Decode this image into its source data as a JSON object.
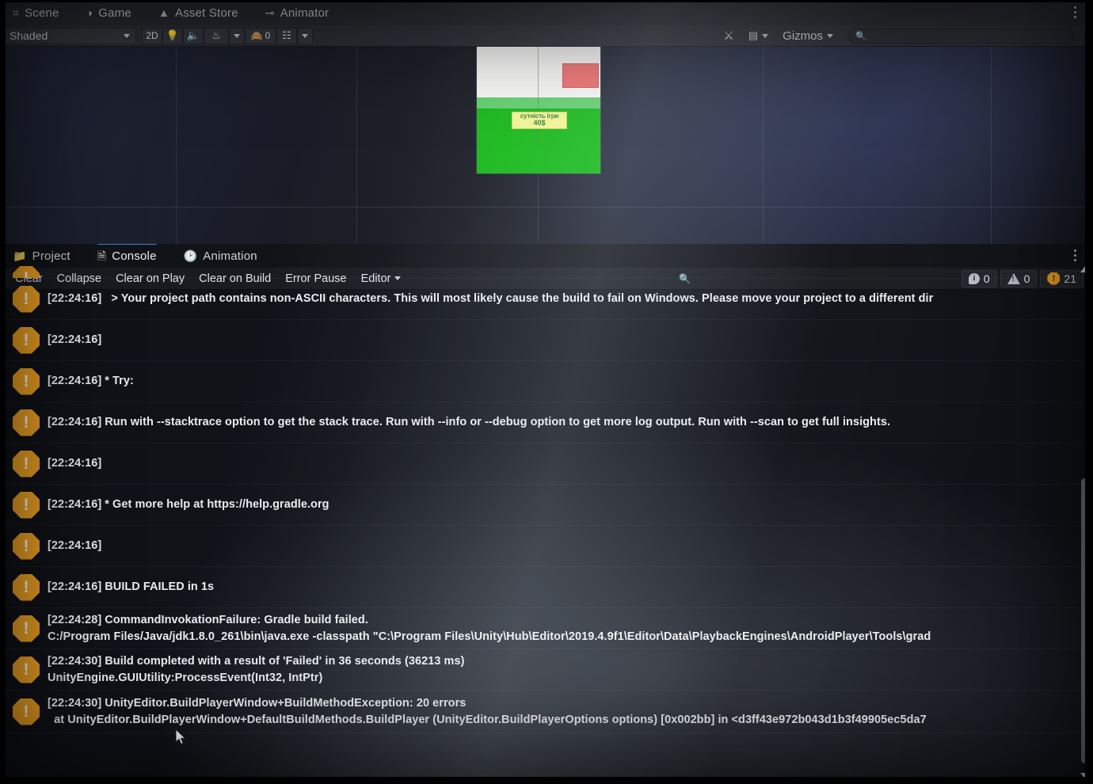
{
  "scene_view": {
    "tabs": [
      {
        "label": "Scene",
        "icon": "grid-icon",
        "glyph": "⌗",
        "active": false
      },
      {
        "label": "Game",
        "icon": "gamepad-icon",
        "glyph": "◑",
        "active": false
      },
      {
        "label": "Asset Store",
        "icon": "shopping-bag-icon",
        "glyph": "▲",
        "active": false
      },
      {
        "label": "Animator",
        "icon": "animator-icon",
        "glyph": "⊸",
        "active": false
      }
    ],
    "toolbar": {
      "draw_mode": "Shaded",
      "two_d_label": "2D",
      "lighting_icon": "lightbulb-icon",
      "audio_icon": "speaker-icon",
      "fx_icon": "effects-icon",
      "hidden_objects_icon": "eye-slash-icon",
      "hidden_objects_count": "0",
      "scene_visibility_icon": "scene-visibility-icon",
      "tools_icon": "tools-icon",
      "camera_icon": "camera-icon",
      "gizmos_label": "Gizmos",
      "search_placeholder": ""
    },
    "game_object": {
      "label_line1": "сутність ігри",
      "label_line2": "40$",
      "sky_color": "#fbfbf9",
      "ground_color": "#0fb50f",
      "ground_light_color": "#5fcf6a",
      "box_color": "#f26b6b",
      "label_bg": "#f2f58f"
    }
  },
  "console": {
    "tabs": [
      {
        "label": "Project",
        "icon": "folder-icon",
        "glyph": "▰",
        "active": false
      },
      {
        "label": "Console",
        "icon": "console-icon",
        "glyph": "⌸",
        "active": true
      },
      {
        "label": "Animation",
        "icon": "clock-icon",
        "glyph": "◔",
        "active": false
      }
    ],
    "toolbar": {
      "clear": "Clear",
      "collapse": "Collapse",
      "clear_on_play": "Clear on Play",
      "clear_on_build": "Clear on Build",
      "error_pause": "Error Pause",
      "editor": "Editor",
      "search_icon": "search-icon",
      "search_value": "",
      "search_placeholder": ""
    },
    "counters": {
      "info_icon": "info-icon",
      "info_count": "0",
      "warning_icon": "warning-icon",
      "warning_count": "0",
      "error_icon": "error-icon",
      "error_count": "21"
    },
    "log_entries": [
      {
        "icon": "error-icon",
        "clipped_top": true,
        "line1": "",
        "line2": ""
      },
      {
        "icon": "error-icon",
        "line1": "[22:24:16]   > Your project path contains non-ASCII characters. This will most likely cause the build to fail on Windows. Please move your project to a different dir",
        "line2": ""
      },
      {
        "icon": "error-icon",
        "line1": "[22:24:16]",
        "line2": ""
      },
      {
        "icon": "error-icon",
        "line1": "[22:24:16] * Try:",
        "line2": ""
      },
      {
        "icon": "error-icon",
        "line1": "[22:24:16] Run with --stacktrace option to get the stack trace. Run with --info or --debug option to get more log output. Run with --scan to get full insights.",
        "line2": ""
      },
      {
        "icon": "error-icon",
        "line1": "[22:24:16]",
        "line2": ""
      },
      {
        "icon": "error-icon",
        "line1": "[22:24:16] * Get more help at https://help.gradle.org",
        "line2": ""
      },
      {
        "icon": "error-icon",
        "line1": "[22:24:16]",
        "line2": ""
      },
      {
        "icon": "error-icon",
        "line1": "[22:24:16] BUILD FAILED in 1s",
        "line2": ""
      },
      {
        "icon": "error-icon",
        "line1": "[22:24:28] CommandInvokationFailure: Gradle build failed.",
        "line2": "C:/Program Files/Java/jdk1.8.0_261\\bin\\java.exe -classpath \"C:\\Program Files\\Unity\\Hub\\Editor\\2019.4.9f1\\Editor\\Data\\PlaybackEngines\\AndroidPlayer\\Tools\\grad"
      },
      {
        "icon": "error-icon",
        "line1": "[22:24:30] Build completed with a result of 'Failed' in 36 seconds (36213 ms)",
        "line2": "UnityEngine.GUIUtility:ProcessEvent(Int32, IntPtr)"
      },
      {
        "icon": "error-icon",
        "line1": "[22:24:30] UnityEditor.BuildPlayerWindow+BuildMethodException: 20 errors",
        "line2": "  at UnityEditor.BuildPlayerWindow+DefaultBuildMethods.BuildPlayer (UnityEditor.BuildPlayerOptions options) [0x002bb] in <d3ff43e972b043d1b3f49905ec5da7"
      }
    ],
    "scrollbar": {
      "up_arrow_icon": "scroll-up-arrow-icon",
      "down_arrow_icon": "scroll-down-arrow-icon"
    }
  },
  "window": {
    "overflow_menu_icon": "kebab-menu-icon",
    "accent_color": "#3e7fd4",
    "error_color": "#f5a623"
  }
}
